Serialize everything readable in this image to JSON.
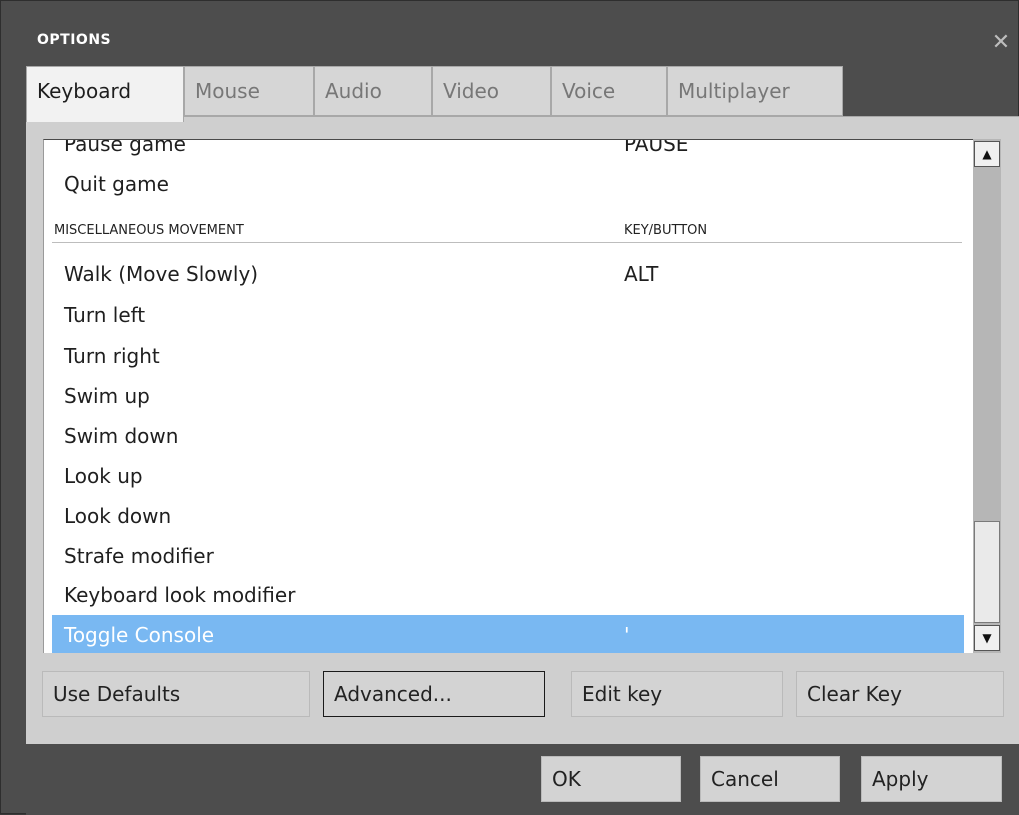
{
  "window": {
    "title": "OPTIONS",
    "close_glyph": "✕"
  },
  "tabs": [
    {
      "label": "Keyboard",
      "active": true
    },
    {
      "label": "Mouse",
      "active": false
    },
    {
      "label": "Audio",
      "active": false
    },
    {
      "label": "Video",
      "active": false
    },
    {
      "label": "Voice",
      "active": false
    },
    {
      "label": "Multiplayer",
      "active": false
    }
  ],
  "bindings": {
    "top_rows": [
      {
        "action": "Pause game",
        "key": "PAUSE"
      },
      {
        "action": "Quit game",
        "key": ""
      }
    ],
    "section": {
      "action_header": "MISCELLANEOUS MOVEMENT",
      "key_header": "KEY/BUTTON"
    },
    "rows": [
      {
        "action": "Walk (Move Slowly)",
        "key": "ALT"
      },
      {
        "action": "Turn left",
        "key": ""
      },
      {
        "action": "Turn right",
        "key": ""
      },
      {
        "action": "Swim up",
        "key": ""
      },
      {
        "action": "Swim down",
        "key": ""
      },
      {
        "action": "Look up",
        "key": ""
      },
      {
        "action": "Look down",
        "key": ""
      },
      {
        "action": "Strafe modifier",
        "key": ""
      },
      {
        "action": "Keyboard look modifier",
        "key": ""
      },
      {
        "action": "Toggle Console",
        "key": "'",
        "selected": true
      }
    ]
  },
  "scrollbar": {
    "up_glyph": "▲",
    "down_glyph": "▼"
  },
  "actions": {
    "use_defaults": "Use Defaults",
    "advanced": "Advanced...",
    "edit_key": "Edit key",
    "clear_key": "Clear Key"
  },
  "dialog_buttons": {
    "ok": "OK",
    "cancel": "Cancel",
    "apply": "Apply"
  },
  "colors": {
    "selection": "#79b8f2",
    "window_bg": "#4d4d4d",
    "panel_bg": "#cfcfcf"
  }
}
